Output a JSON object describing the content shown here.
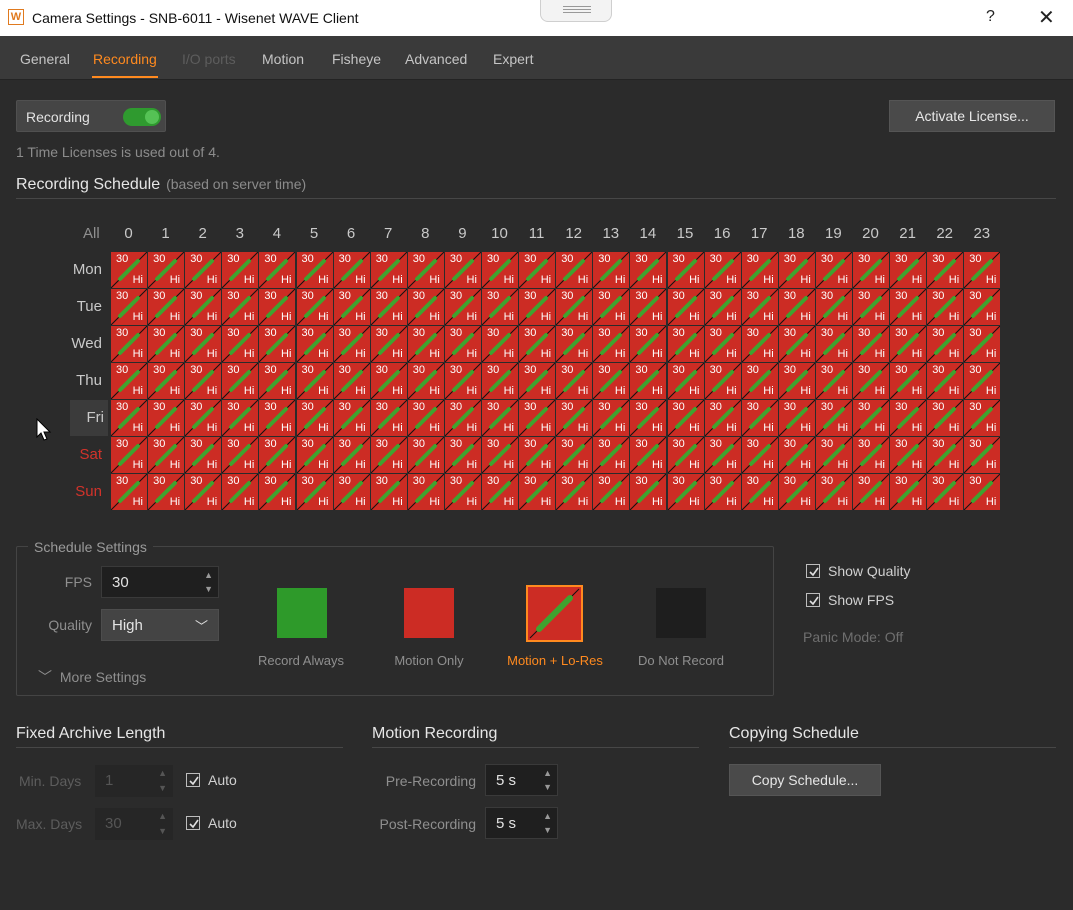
{
  "window": {
    "title": "Camera Settings - SNB-6011 - Wisenet WAVE Client",
    "logo": "W",
    "help": "?",
    "close": "✕"
  },
  "tabs": [
    {
      "label": "General",
      "state": "normal"
    },
    {
      "label": "Recording",
      "state": "active"
    },
    {
      "label": "I/O ports",
      "state": "disabled"
    },
    {
      "label": "Motion",
      "state": "normal"
    },
    {
      "label": "Fisheye",
      "state": "normal"
    },
    {
      "label": "Advanced",
      "state": "normal"
    },
    {
      "label": "Expert",
      "state": "normal"
    }
  ],
  "recording": {
    "label": "Recording",
    "enabled": true,
    "activate_license": "Activate License...",
    "license_info": "1 Time Licenses is used out of 4."
  },
  "schedule": {
    "title": "Recording Schedule",
    "subtitle": "(based on server time)",
    "all_label": "All",
    "hours": [
      "0",
      "1",
      "2",
      "3",
      "4",
      "5",
      "6",
      "7",
      "8",
      "9",
      "10",
      "11",
      "12",
      "13",
      "14",
      "15",
      "16",
      "17",
      "18",
      "19",
      "20",
      "21",
      "22",
      "23"
    ],
    "days": [
      "Mon",
      "Tue",
      "Wed",
      "Thu",
      "Fri",
      "Sat",
      "Sun"
    ],
    "cell_fps": "30",
    "cell_quality": "Hi",
    "cell_color": "#cc2c24",
    "cell_mark_color": "#3fa32f"
  },
  "schedule_settings": {
    "title": "Schedule Settings",
    "fps_label": "FPS",
    "fps_value": "30",
    "quality_label": "Quality",
    "quality_value": "High",
    "more_settings": "More Settings",
    "modes": [
      {
        "label": "Record Always",
        "color": "#2e9a2a",
        "active": false
      },
      {
        "label": "Motion Only",
        "color": "#cc2c24",
        "active": false
      },
      {
        "label": "Motion + Lo-Res",
        "color": "#cc2c24",
        "active": true
      },
      {
        "label": "Do Not Record",
        "color": "#1e1e1e",
        "active": false
      }
    ],
    "show_quality": "Show Quality",
    "show_fps": "Show FPS",
    "panic_mode": "Panic Mode: Off"
  },
  "archive": {
    "title": "Fixed Archive Length",
    "min_label": "Min. Days",
    "min_value": "1",
    "max_label": "Max. Days",
    "max_value": "30",
    "auto_label": "Auto"
  },
  "motion_recording": {
    "title": "Motion Recording",
    "pre_label": "Pre-Recording",
    "pre_value": "5 s",
    "post_label": "Post-Recording",
    "post_value": "5 s"
  },
  "copying": {
    "title": "Copying Schedule",
    "button": "Copy Schedule..."
  },
  "accent_color": "#ff8a1f"
}
